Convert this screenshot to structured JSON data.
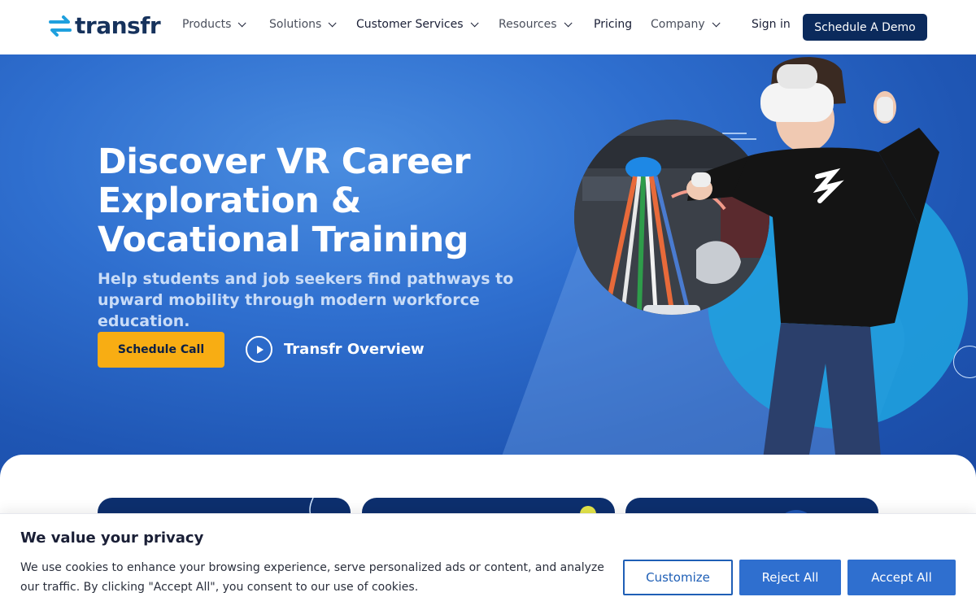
{
  "brand": {
    "name": "transfr"
  },
  "nav": {
    "items": [
      {
        "label": "Products",
        "has_menu": true
      },
      {
        "label": "Solutions",
        "has_menu": true
      },
      {
        "label": "Customer Services",
        "has_menu": true
      },
      {
        "label": "Resources",
        "has_menu": true
      },
      {
        "label": "Pricing",
        "has_menu": false
      },
      {
        "label": "Company",
        "has_menu": true
      }
    ],
    "sign_in": "Sign in",
    "demo_button": "Schedule A Demo"
  },
  "hero": {
    "headline": "Discover VR Career Exploration & Vocational Training",
    "subheadline": "Help students and job seekers find pathways to upward mobility through modern workforce education.",
    "cta_primary": "Schedule Call",
    "cta_video": "Transfr Overview"
  },
  "cookie": {
    "title": "We value your privacy",
    "text": "We use cookies to enhance your browsing experience, serve personalized ads or content, and analyze our traffic. By clicking \"Accept All\", you consent to our use of cookies.",
    "customize": "Customize",
    "reject": "Reject All",
    "accept": "Accept All"
  },
  "colors": {
    "navy": "#0b2a5c",
    "hero_blue": "#2f6fcf",
    "accent_yellow": "#f8ad13",
    "cookie_button": "#2f6fcf"
  }
}
